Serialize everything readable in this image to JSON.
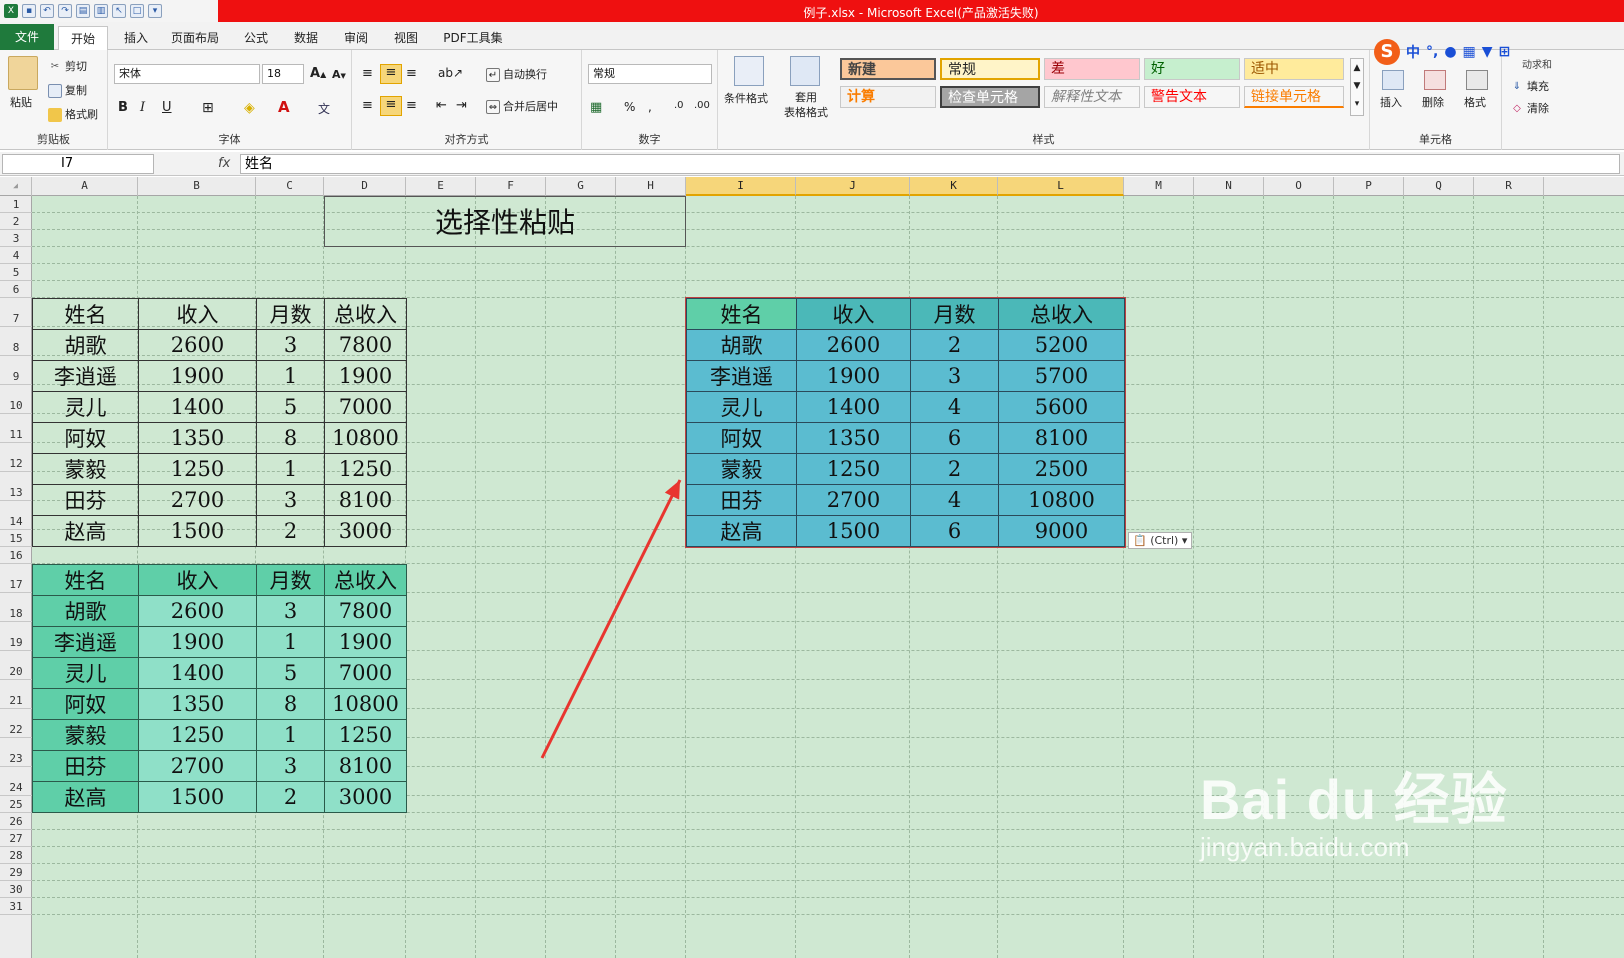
{
  "title_bar": {
    "text": "例子.xlsx - Microsoft Excel(产品激活失败)"
  },
  "tabs": [
    {
      "label": "文件"
    },
    {
      "label": "开始"
    },
    {
      "label": "插入"
    },
    {
      "label": "页面布局"
    },
    {
      "label": "公式"
    },
    {
      "label": "数据"
    },
    {
      "label": "审阅"
    },
    {
      "label": "视图"
    },
    {
      "label": "PDF工具集"
    }
  ],
  "ribbon": {
    "clipboard": {
      "paste": "粘贴",
      "cut": "剪切",
      "copy": "复制",
      "format_painter": "格式刷",
      "label": "剪贴板"
    },
    "font": {
      "name": "宋体",
      "size": "18",
      "label": "字体"
    },
    "alignment": {
      "wrap": "自动换行",
      "merge": "合并后居中",
      "label": "对齐方式"
    },
    "number": {
      "format": "常规",
      "label": "数字"
    },
    "styles": {
      "cond_format": "条件格式",
      "table_format": "套用\n表格格式",
      "cells": [
        "新建",
        "常规",
        "差",
        "好",
        "适中",
        "计算",
        "检查单元格",
        "解释性文本",
        "警告文本",
        "链接单元格"
      ],
      "label": "样式"
    },
    "cells_group": {
      "insert": "插入",
      "delete": "删除",
      "format": "格式",
      "label": "单元格"
    },
    "editing": {
      "fill": "填充",
      "clear": "清除",
      "autosum_partial": "动求和"
    }
  },
  "formula_bar": {
    "name_box": "I7",
    "fx": "fx",
    "formula": "姓名"
  },
  "sheet": {
    "columns": [
      "A",
      "B",
      "C",
      "D",
      "E",
      "F",
      "G",
      "H",
      "I",
      "J",
      "K",
      "L",
      "M",
      "N",
      "O",
      "P",
      "Q",
      "R"
    ],
    "selected_columns": [
      "I",
      "J",
      "K",
      "L"
    ],
    "rows": [
      "1",
      "2",
      "3",
      "4",
      "5",
      "6",
      "7",
      "8",
      "9",
      "10",
      "11",
      "12",
      "13",
      "14",
      "15",
      "16",
      "17",
      "18",
      "19",
      "20",
      "21",
      "22",
      "23",
      "24",
      "25",
      "26",
      "27",
      "28",
      "29",
      "30",
      "31"
    ],
    "title": "选择性粘贴",
    "header": [
      "姓名",
      "收入",
      "月数",
      "总收入"
    ],
    "table1": [
      [
        "胡歌",
        "2600",
        "3",
        "7800"
      ],
      [
        "李逍遥",
        "1900",
        "1",
        "1900"
      ],
      [
        "灵儿",
        "1400",
        "5",
        "7000"
      ],
      [
        "阿奴",
        "1350",
        "8",
        "10800"
      ],
      [
        "蒙毅",
        "1250",
        "1",
        "1250"
      ],
      [
        "田芬",
        "2700",
        "3",
        "8100"
      ],
      [
        "赵高",
        "1500",
        "2",
        "3000"
      ]
    ],
    "table2": [
      [
        "胡歌",
        "2600",
        "3",
        "7800"
      ],
      [
        "李逍遥",
        "1900",
        "1",
        "1900"
      ],
      [
        "灵儿",
        "1400",
        "5",
        "7000"
      ],
      [
        "阿奴",
        "1350",
        "8",
        "10800"
      ],
      [
        "蒙毅",
        "1250",
        "1",
        "1250"
      ],
      [
        "田芬",
        "2700",
        "3",
        "8100"
      ],
      [
        "赵高",
        "1500",
        "2",
        "3000"
      ]
    ],
    "table3": [
      [
        "胡歌",
        "2600",
        "2",
        "5200"
      ],
      [
        "李逍遥",
        "1900",
        "3",
        "5700"
      ],
      [
        "灵儿",
        "1400",
        "4",
        "5600"
      ],
      [
        "阿奴",
        "1350",
        "6",
        "8100"
      ],
      [
        "蒙毅",
        "1250",
        "2",
        "2500"
      ],
      [
        "田芬",
        "2700",
        "4",
        "10800"
      ],
      [
        "赵高",
        "1500",
        "6",
        "9000"
      ]
    ],
    "paste_options": "(Ctrl)"
  },
  "watermark": {
    "main": "Bai du 经验",
    "sub": "jingyan.baidu.com"
  },
  "colors": {
    "title_red": "#ef1010",
    "grid_bg": "#cfe8d2",
    "header_teal": "#5fcfa8",
    "body_teal": "#8fe0c8",
    "paste_header": "#4bb8b8",
    "paste_body": "#5bbcd0",
    "selected_col": "#f6d67a",
    "arrow": "#e8352f"
  }
}
